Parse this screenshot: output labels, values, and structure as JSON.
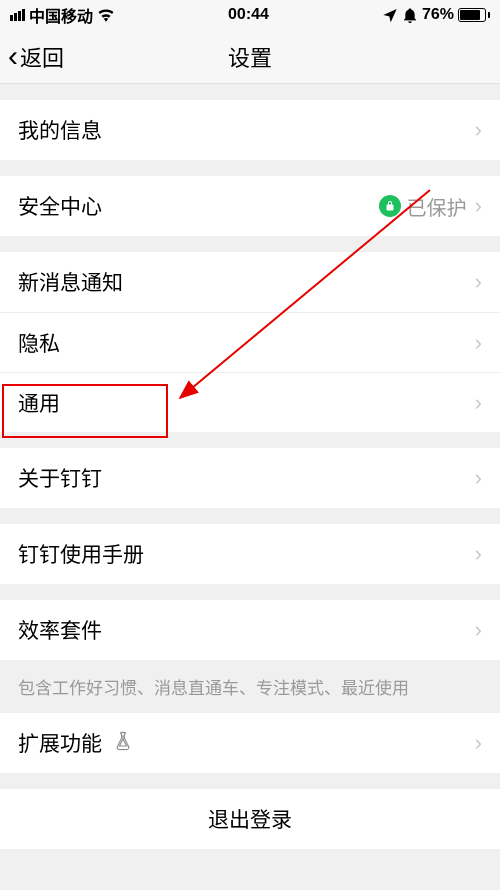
{
  "status": {
    "carrier": "中国移动",
    "time": "00:44",
    "battery_pct": "76%"
  },
  "nav": {
    "back_label": "返回",
    "title": "设置"
  },
  "cells": {
    "my_info": "我的信息",
    "security_center": "安全中心",
    "security_status": "已保护",
    "new_msg": "新消息通知",
    "privacy": "隐私",
    "general": "通用",
    "about": "关于钉钉",
    "manual": "钉钉使用手册",
    "efficiency": "效率套件",
    "efficiency_hint": "包含工作好习惯、消息直通车、专注模式、最近使用",
    "extensions": "扩展功能"
  },
  "logout": "退出登录"
}
